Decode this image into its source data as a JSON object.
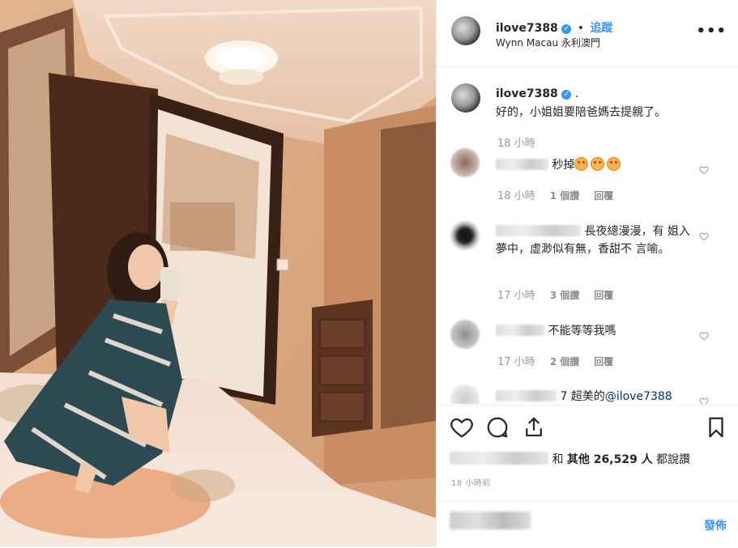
{
  "header": {
    "username": "ilove7388",
    "separator": "•",
    "follow_label": "追蹤",
    "location": "Wynn Macau 永利澳門",
    "more_label": "•••"
  },
  "caption": {
    "username": "ilove7388",
    "text": "好的，小姐姐要陪爸媽去提親了。",
    "time": "18 小時"
  },
  "comments": [
    {
      "text": "秒掉",
      "emoji_count": 3,
      "time": "18 小時",
      "likes": "1 個讚",
      "reply": "回覆"
    },
    {
      "text": "長夜總漫漫，有 姐入夢中，虛渺似有無，香甜不 言喻。",
      "time": "17 小時",
      "likes": "3 個讚",
      "reply": "回覆"
    },
    {
      "text": "不能等等我嗎",
      "time": "17 小時",
      "likes": "2 個讚",
      "reply": "回覆"
    },
    {
      "text": "7 超美的",
      "mention": "@ilove7388"
    }
  ],
  "actions": {
    "likes_prefix": "和",
    "likes_label": "其他 26,529 人",
    "likes_suffix": "都說讚",
    "posted_time": "18 小時前"
  },
  "compose": {
    "post_label": "發佈"
  },
  "colors": {
    "accent": "#3897f0",
    "muted": "#999999",
    "text": "#262626"
  }
}
